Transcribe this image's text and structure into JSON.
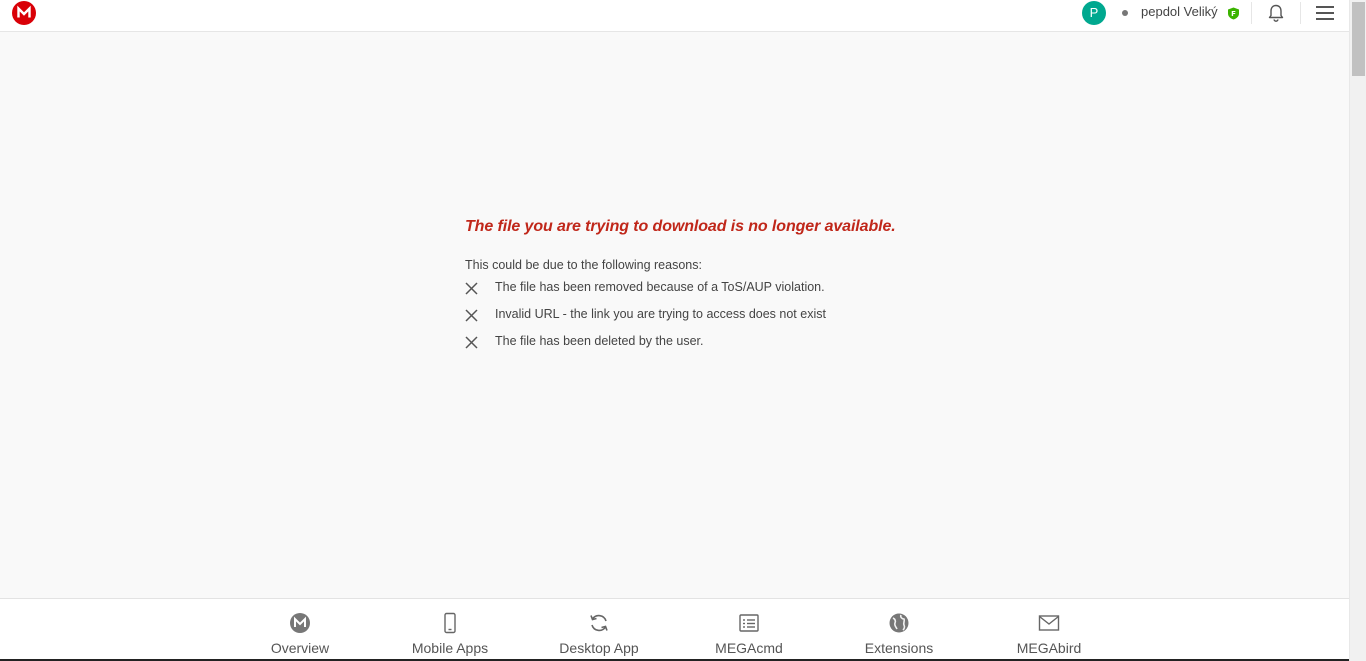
{
  "header": {
    "logo_icon": "mega-logo-icon",
    "avatar_letter": "P",
    "username": "pepdol Veliký",
    "badge_icon": "shield-icon",
    "notification_icon": "bell-icon",
    "menu_icon": "hamburger-menu-icon"
  },
  "main": {
    "title": "The file you are trying to download is no longer available.",
    "intro": "This could be due to the following reasons:",
    "reasons": [
      "The file has been removed because of a ToS/AUP violation.",
      "Invalid URL - the link you are trying to access does not exist",
      "The file has been deleted by the user."
    ]
  },
  "footer": {
    "items": [
      {
        "label": "Overview",
        "icon": "mega-logo-icon"
      },
      {
        "label": "Mobile Apps",
        "icon": "phone-icon"
      },
      {
        "label": "Desktop App",
        "icon": "sync-icon"
      },
      {
        "label": "MEGAcmd",
        "icon": "terminal-list-icon"
      },
      {
        "label": "Extensions",
        "icon": "globe-icon"
      },
      {
        "label": "MEGAbird",
        "icon": "mail-icon"
      }
    ]
  },
  "colors": {
    "brand_red": "#d90007",
    "error_title": "#c0271a",
    "avatar_teal": "#00a88f",
    "badge_green": "#3bb300"
  }
}
